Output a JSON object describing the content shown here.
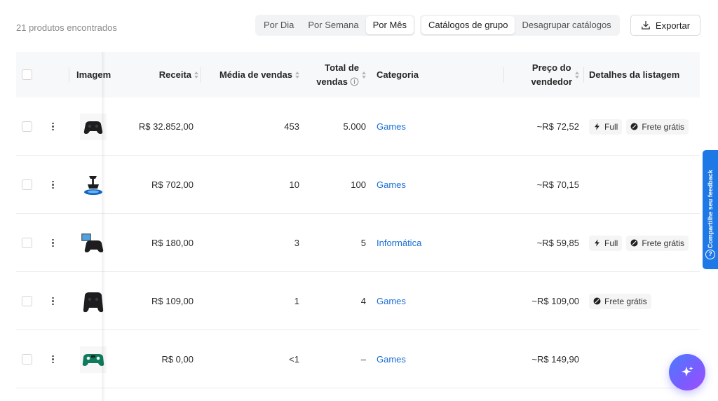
{
  "summary": {
    "count_text": "21 produtos encontrados"
  },
  "period": {
    "options": [
      "Por Dia",
      "Por Semana",
      "Por Mês"
    ],
    "active": 2
  },
  "catalog": {
    "options": [
      "Catálogos de grupo",
      "Desagrupar catálogos"
    ],
    "active": 0
  },
  "export": {
    "label": "Exportar"
  },
  "table": {
    "headers": {
      "image": "Imagem",
      "revenue": "Receita",
      "avg_sales": "Média de vendas",
      "total_sales_line1": "Total de",
      "total_sales_line2": "vendas",
      "category": "Categoria",
      "price_line1": "Preço do",
      "price_line2": "vendedor",
      "details": "Detalhes da listagem"
    },
    "rows": [
      {
        "revenue": "R$ 32.852,00",
        "avg_sales": "453",
        "total_sales": "5.000",
        "category": "Games",
        "price": "~R$ 72,52",
        "tags": [
          "Full",
          "Frete grátis"
        ],
        "image": "black-controller-icon"
      },
      {
        "revenue": "R$ 702,00",
        "avg_sales": "10",
        "total_sales": "100",
        "category": "Games",
        "price": "~R$ 70,15",
        "tags": [],
        "image": "controller-stand-icon"
      },
      {
        "revenue": "R$ 180,00",
        "avg_sales": "3",
        "total_sales": "5",
        "category": "Informática",
        "price": "~R$ 59,85",
        "tags": [
          "Full",
          "Frete grátis"
        ],
        "image": "screen-controller-icon"
      },
      {
        "revenue": "R$ 109,00",
        "avg_sales": "1",
        "total_sales": "4",
        "category": "Games",
        "price": "~R$ 109,00",
        "tags": [
          "Frete grátis"
        ],
        "image": "black-controller-icon"
      },
      {
        "revenue": "R$ 0,00",
        "avg_sales": "<1",
        "total_sales": "–",
        "category": "Games",
        "price": "~R$ 149,90",
        "tags": [],
        "image": "green-controller-icon"
      }
    ]
  },
  "feedback": {
    "label": "Compartilhe seu feedback",
    "help": "?"
  },
  "colors": {
    "link": "#1a6fd6",
    "feedback_bg": "#1e78e6",
    "fab_start": "#4a7bff",
    "fab_end": "#a24dff"
  }
}
